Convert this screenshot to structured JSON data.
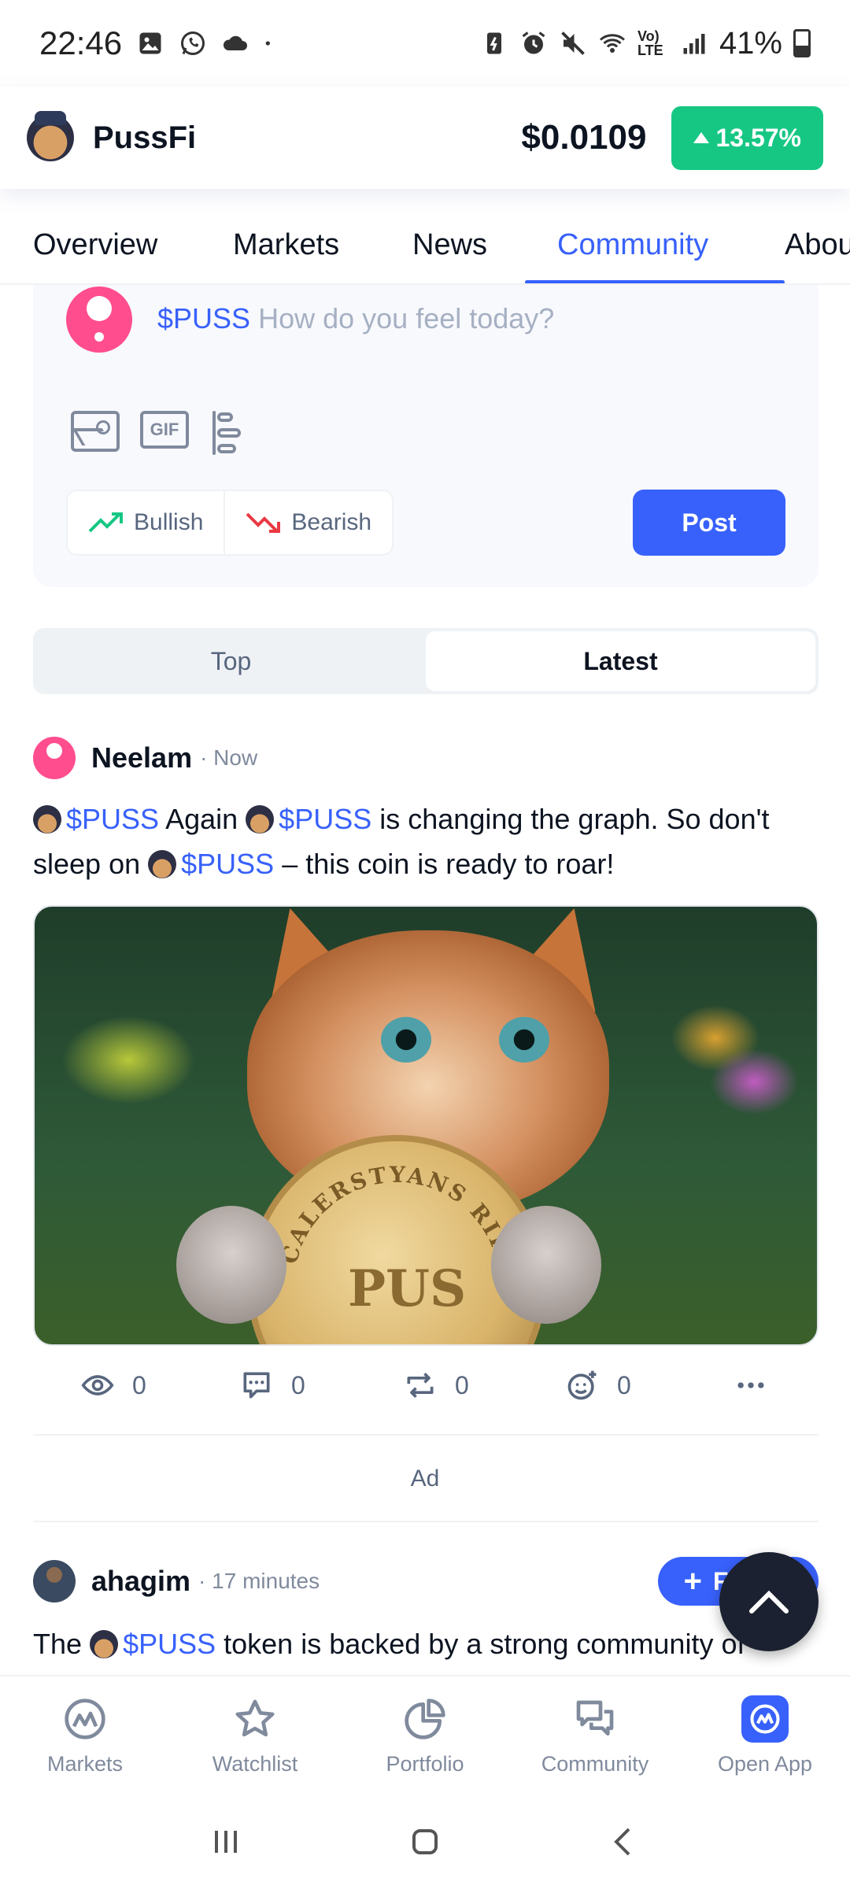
{
  "status_bar": {
    "time": "22:46",
    "battery": "41%",
    "network": "Vo) LTE"
  },
  "coin": {
    "name": "PussFi",
    "price": "$0.0109",
    "change": "13.57%",
    "change_color": "#16c784"
  },
  "tabs": [
    {
      "label": "Overview"
    },
    {
      "label": "Markets"
    },
    {
      "label": "News"
    },
    {
      "label": "Community"
    },
    {
      "label": "Abou"
    }
  ],
  "composer": {
    "tag": "$PUSS",
    "placeholder": "How do you feel today?",
    "tools": [
      "image-icon",
      "gif-icon",
      "poll-icon"
    ],
    "gif_label": "GIF",
    "bullish": "Bullish",
    "bearish": "Bearish",
    "post": "Post"
  },
  "feed_toggle": {
    "top": "Top",
    "latest": "Latest",
    "selected": "Latest"
  },
  "post1": {
    "author": "Neelam",
    "time": "· Now",
    "segments": {
      "tag1": "$PUSS",
      "t1": "Again",
      "tag2": "$PUSS",
      "t2": "is changing the graph. So don't sleep on",
      "tag3": "$PUSS",
      "t3": "– this coin is ready to roar!"
    },
    "image_coin_text": "PUS",
    "image_coin_rim": "CALERSTYANS RIRIT",
    "stats": {
      "views": "0",
      "comments": "0",
      "reposts": "0",
      "reactions": "0"
    }
  },
  "ad_label": "Ad",
  "post2": {
    "author": "ahagim",
    "time": "· 17 minutes",
    "follow": "Follow",
    "t1": "The",
    "tag1": "$PUSS",
    "t2": "token is backed by a strong community of"
  },
  "bottom_nav": [
    {
      "label": "Markets",
      "icon": "markets-icon"
    },
    {
      "label": "Watchlist",
      "icon": "star-icon"
    },
    {
      "label": "Portfolio",
      "icon": "pie-chart-icon"
    },
    {
      "label": "Community",
      "icon": "chat-bubbles-icon"
    },
    {
      "label": "Open App",
      "icon": "app-icon"
    }
  ],
  "colors": {
    "accent": "#3861fb",
    "positive": "#16c784",
    "negative": "#ea3943"
  }
}
